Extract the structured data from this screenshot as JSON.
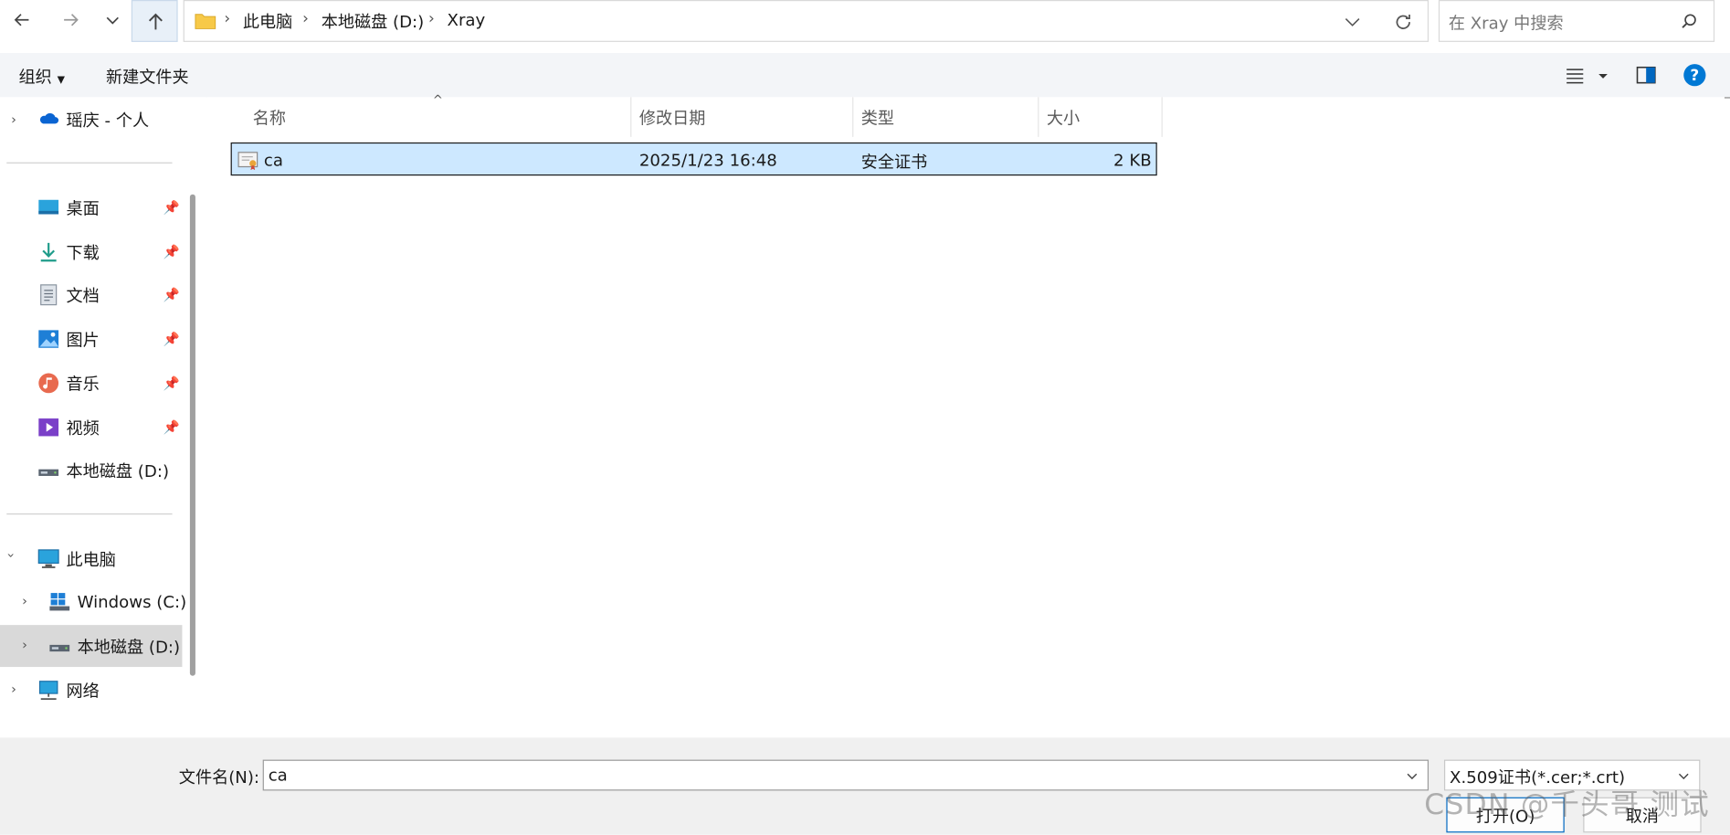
{
  "address": {
    "crumbs": [
      "此电脑",
      "本地磁盘 (D:)",
      "Xray"
    ]
  },
  "search": {
    "placeholder": "在 Xray 中搜索"
  },
  "toolbar": {
    "organize": "组织",
    "new_folder": "新建文件夹"
  },
  "sidebar": {
    "onedrive": "瑶庆 - 个人",
    "quick": [
      {
        "label": "桌面"
      },
      {
        "label": "下载"
      },
      {
        "label": "文档"
      },
      {
        "label": "图片"
      },
      {
        "label": "音乐"
      },
      {
        "label": "视频"
      },
      {
        "label": "本地磁盘 (D:)"
      }
    ],
    "this_pc": "此电脑",
    "drives": [
      "Windows (C:)",
      "本地磁盘 (D:)"
    ],
    "network": "网络"
  },
  "columns": {
    "name": "名称",
    "modified": "修改日期",
    "type": "类型",
    "size": "大小"
  },
  "files": [
    {
      "name": "ca",
      "modified": "2025/1/23 16:48",
      "type": "安全证书",
      "size": "2 KB"
    }
  ],
  "footer": {
    "filename_label": "文件名(N):",
    "filename_value": "ca",
    "filter": "X.509证书(*.cer;*.crt)",
    "open": "打开(O)",
    "cancel": "取消"
  },
  "watermark": "CSDN @千头哥 测试",
  "colors": {
    "selection": "#cde8ff",
    "accent": "#0067c0",
    "folder": "#f7c948"
  }
}
